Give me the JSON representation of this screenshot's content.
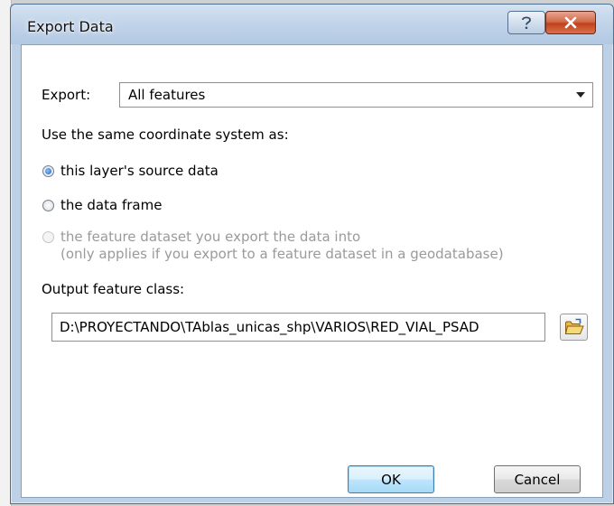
{
  "window": {
    "title": "Export Data"
  },
  "export": {
    "label": "Export:",
    "selected": "All features"
  },
  "coordinate_system": {
    "heading": "Use the same coordinate system as:",
    "options": [
      {
        "label": "this layer's source data",
        "checked": true,
        "enabled": true
      },
      {
        "label": "the data frame",
        "checked": false,
        "enabled": true
      },
      {
        "label": "the feature dataset you export the data into",
        "sublabel": "(only applies if you export to a feature dataset in a geodatabase)",
        "checked": false,
        "enabled": false
      }
    ]
  },
  "output": {
    "label": "Output feature class:",
    "value": "D:\\PROYECTANDO\\TAblas_unicas_shp\\VARIOS\\RED_VIAL_PSAD"
  },
  "buttons": {
    "ok": "OK",
    "cancel": "Cancel"
  },
  "icons": {
    "help": "help-icon",
    "close": "close-icon",
    "dropdown": "chevron-down-icon",
    "browse": "folder-icon"
  },
  "colors": {
    "accent": "#1c5fb8",
    "close_button": "#c2411c"
  }
}
